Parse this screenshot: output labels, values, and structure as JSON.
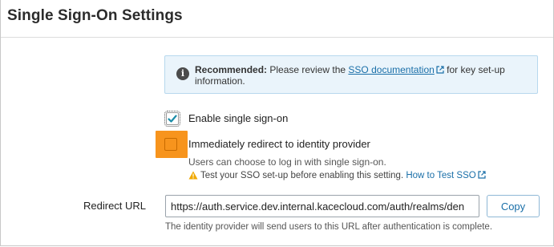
{
  "page": {
    "title": "Single Sign-On Settings"
  },
  "info": {
    "icon": "info-circle-icon",
    "bold": "Recommended:",
    "pre_link": " Please review the ",
    "link_text": "SSO documentation",
    "post_link": " for key set-up",
    "line2": "information."
  },
  "enable_sso": {
    "label": "Enable single sign-on",
    "checked": true
  },
  "redirect_idp": {
    "label": "Immediately redirect to identity provider",
    "checked": false,
    "help": "Users can choose to log in with single sign-on.",
    "warning": "Test your SSO set-up before enabling this setting.",
    "warning_link": "How to Test SSO",
    "warning_icon": "warning-triangle-icon"
  },
  "redirect_url": {
    "label": "Redirect URL",
    "value": "https://auth.service.dev.internal.kacecloud.com/auth/realms/den",
    "copy_label": "Copy",
    "help": "The identity provider will send users to this URL after authentication is complete."
  },
  "colors": {
    "accent": "#1a6fa8",
    "highlight": "#f7941d",
    "info_bg": "#eaf4fb",
    "checkmark": "#1a8ca8",
    "warning": "#f0a800"
  }
}
